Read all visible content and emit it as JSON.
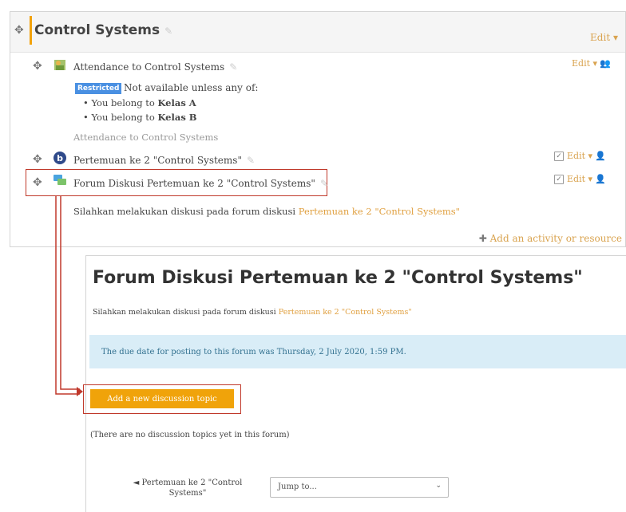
{
  "section": {
    "title": "Control Systems",
    "edit_label": "Edit",
    "activities": [
      {
        "name": "Attendance to Control Systems",
        "icon": "attendance-icon",
        "edit_label": "Edit",
        "restriction": {
          "badge": "Restricted",
          "text": "Not available unless any of:",
          "conditions": [
            {
              "prefix": "You belong to",
              "group": "Kelas A"
            },
            {
              "prefix": "You belong to",
              "group": "Kelas B"
            }
          ]
        },
        "description": "Attendance to Control Systems"
      },
      {
        "name": "Pertemuan ke 2 \"Control Systems\"",
        "icon": "bigbluebutton-icon",
        "edit_label": "Edit"
      },
      {
        "name": "Forum Diskusi Pertemuan ke 2 \"Control Systems\"",
        "icon": "forum-icon",
        "edit_label": "Edit"
      }
    ],
    "summary_text": "Silahkan melakukan diskusi pada forum diskusi",
    "summary_link": "Pertemuan ke 2 \"Control Systems\"",
    "add_activity_label": "Add an activity or resource"
  },
  "forum": {
    "title": "Forum Diskusi Pertemuan ke 2 \"Control Systems\"",
    "intro_text": "Silahkan melakukan diskusi pada forum diskusi",
    "intro_link": "Pertemuan ke 2 \"Control Systems\"",
    "due_notice": "The due date for posting to this forum was Thursday, 2 July 2020, 1:59 PM.",
    "add_topic_label": "Add a new discussion topic",
    "no_topics_text": "(There are no discussion topics yet in this forum)",
    "prev_link": "◄ Pertemuan ke 2 \"Control Systems\"",
    "jump_select": "Jump to..."
  },
  "colors": {
    "accent": "#f0a30a",
    "link": "#d9a34f",
    "highlight": "#c0392b",
    "info_bg": "#d9edf7"
  }
}
